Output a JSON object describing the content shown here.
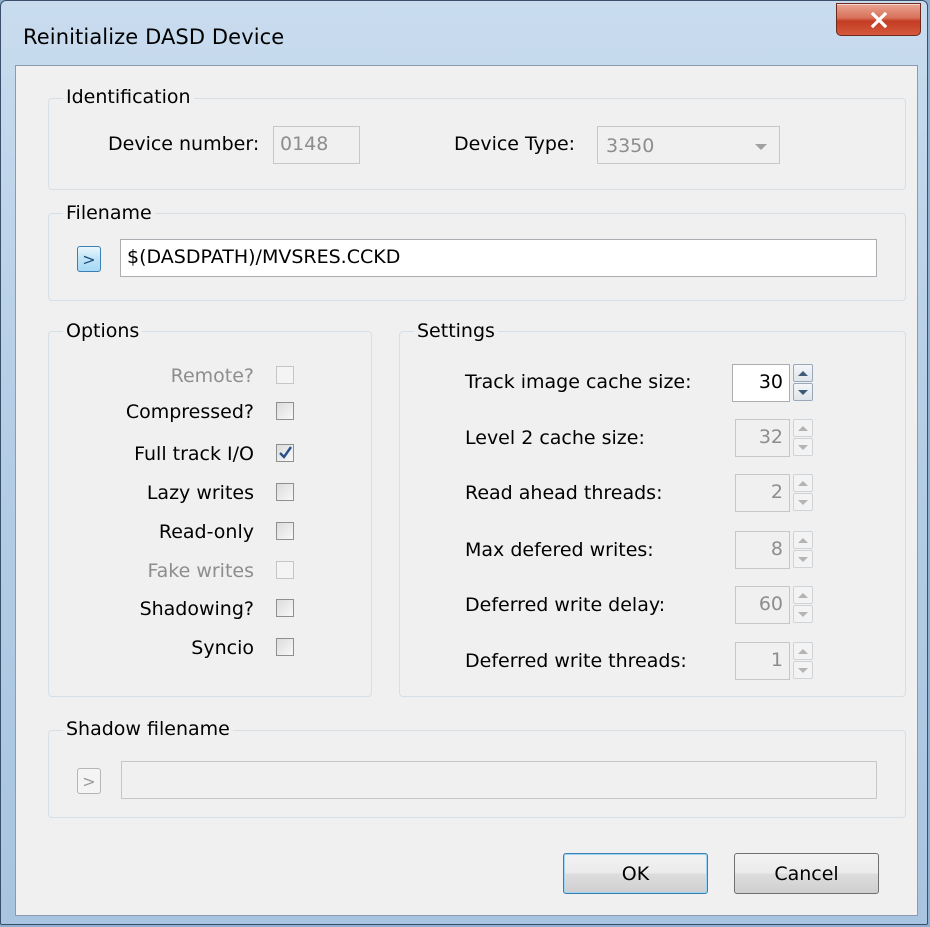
{
  "window": {
    "title": "Reinitialize DASD Device",
    "close_icon": "close-icon"
  },
  "identification": {
    "group_label": "Identification",
    "device_number_label": "Device number:",
    "device_number_value": "0148",
    "device_type_label": "Device Type:",
    "device_type_value": "3350"
  },
  "filename": {
    "group_label": "Filename",
    "browse_label": ">",
    "value": "$(DASDPATH)/MVSRES.CCKD"
  },
  "options": {
    "group_label": "Options",
    "items": [
      {
        "label": "Remote?",
        "checked": false,
        "enabled": false
      },
      {
        "label": "Compressed?",
        "checked": false,
        "enabled": true
      },
      {
        "label": "Full track I/O",
        "checked": true,
        "enabled": true
      },
      {
        "label": "Lazy writes",
        "checked": false,
        "enabled": true
      },
      {
        "label": "Read-only",
        "checked": false,
        "enabled": true
      },
      {
        "label": "Fake writes",
        "checked": false,
        "enabled": false
      },
      {
        "label": "Shadowing?",
        "checked": false,
        "enabled": true
      },
      {
        "label": "Syncio",
        "checked": false,
        "enabled": true
      }
    ]
  },
  "settings": {
    "group_label": "Settings",
    "items": [
      {
        "label": "Track image cache size:",
        "value": "30",
        "enabled": true
      },
      {
        "label": "Level 2 cache size:",
        "value": "32",
        "enabled": false
      },
      {
        "label": "Read ahead threads:",
        "value": "2",
        "enabled": false
      },
      {
        "label": "Max defered writes:",
        "value": "8",
        "enabled": false
      },
      {
        "label": "Deferred write delay:",
        "value": "60",
        "enabled": false
      },
      {
        "label": "Deferred write threads:",
        "value": "1",
        "enabled": false
      }
    ]
  },
  "shadow": {
    "group_label": "Shadow filename",
    "browse_label": ">",
    "value": ""
  },
  "buttons": {
    "ok": "OK",
    "cancel": "Cancel"
  },
  "colors": {
    "accent": "#3c7fb1",
    "close": "#c23c22",
    "dialog_bg": "#f0f0f0"
  }
}
